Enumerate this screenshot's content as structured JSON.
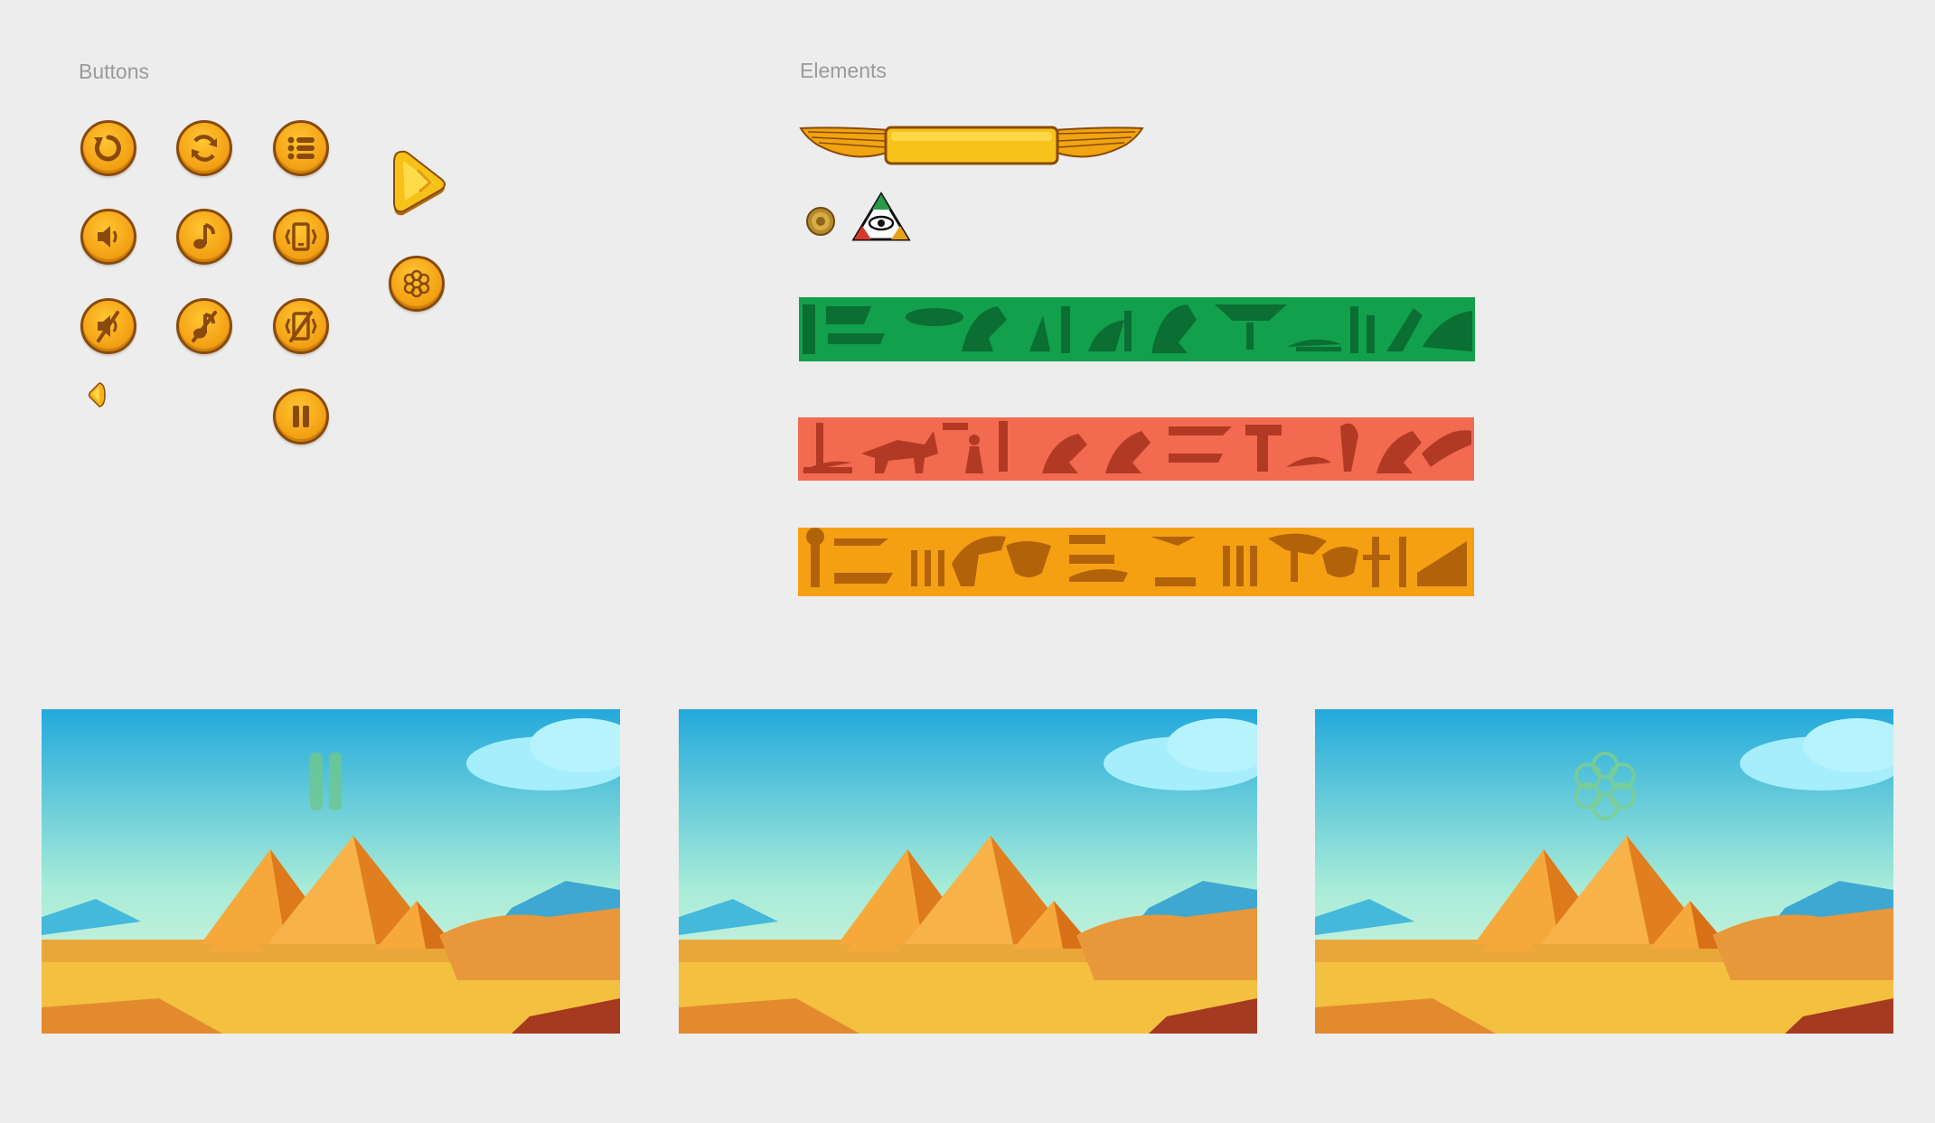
{
  "sections": {
    "buttons_label": "Buttons",
    "elements_label": "Elements"
  },
  "buttons": [
    {
      "name": "restart-icon",
      "action": "restart"
    },
    {
      "name": "refresh-icon",
      "action": "refresh"
    },
    {
      "name": "menu-list-icon",
      "action": "menu"
    },
    {
      "name": "sound-on-icon",
      "action": "sound"
    },
    {
      "name": "music-on-icon",
      "action": "music"
    },
    {
      "name": "vibration-on-icon",
      "action": "vibration"
    },
    {
      "name": "sound-off-icon",
      "action": "sound-off"
    },
    {
      "name": "music-off-icon",
      "action": "music-off"
    },
    {
      "name": "vibration-off-icon",
      "action": "vibration-off"
    },
    {
      "name": "pause-icon",
      "action": "pause"
    },
    {
      "name": "play-icon",
      "action": "play"
    },
    {
      "name": "flower-icon",
      "action": "settings"
    }
  ],
  "elements": [
    {
      "name": "winged-banner"
    },
    {
      "name": "coin-icon"
    },
    {
      "name": "eye-pyramid-icon"
    },
    {
      "name": "hieroglyph-strip-green",
      "color": "#0f9a4a"
    },
    {
      "name": "hieroglyph-strip-red",
      "color": "#f26a4f"
    },
    {
      "name": "hieroglyph-strip-orange",
      "color": "#f5a013"
    }
  ],
  "scenes": [
    {
      "name": "game-scene-pause",
      "overlay": "pause-icon"
    },
    {
      "name": "game-scene-plain",
      "overlay": ""
    },
    {
      "name": "game-scene-flower",
      "overlay": "flower-icon"
    }
  ],
  "colors": {
    "background": "#ededed",
    "button_fill": "#f4a316",
    "button_border": "#8a4a0c",
    "icon": "#8a4a0c",
    "sky_top": "#2db0e0",
    "sand": "#f3c03f",
    "pyramid": "#f0a030"
  }
}
